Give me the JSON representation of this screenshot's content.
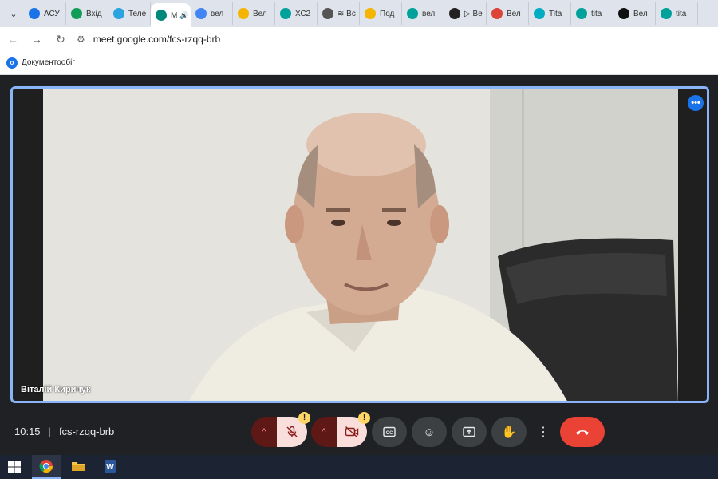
{
  "browser": {
    "tabs": [
      {
        "label": "АСУ",
        "favicon": "od-icon",
        "color": "#1a73e8"
      },
      {
        "label": "Вхід",
        "favicon": "folder-icon",
        "color": "#0f9d58"
      },
      {
        "label": "Теле",
        "favicon": "telegram-icon",
        "color": "#2aa3df"
      },
      {
        "label": "М",
        "favicon": "meet-icon",
        "color": "#00897b",
        "active": true
      },
      {
        "label": "вел",
        "favicon": "google-icon",
        "color": "#4285f4"
      },
      {
        "label": "Вел",
        "favicon": "h-icon",
        "color": "#f4b400"
      },
      {
        "label": "ХС2",
        "favicon": "ok-icon",
        "color": "#00a19a"
      },
      {
        "label": "≋ Вс",
        "favicon": "s-icon",
        "color": "#555555"
      },
      {
        "label": "Под",
        "favicon": "lock-icon",
        "color": "#f4b400"
      },
      {
        "label": "вел",
        "favicon": "ok-icon",
        "color": "#00a19a"
      },
      {
        "label": "▷ Ве",
        "favicon": "b-icon",
        "color": "#222222"
      },
      {
        "label": "Вел",
        "favicon": "target-icon",
        "color": "#db4437"
      },
      {
        "label": "Tita",
        "favicon": "titan-icon",
        "color": "#00acc1"
      },
      {
        "label": "tita",
        "favicon": "ok-icon",
        "color": "#00a19a"
      },
      {
        "label": "Вел",
        "favicon": "i-icon",
        "color": "#111111"
      },
      {
        "label": "tita",
        "favicon": "ok-icon",
        "color": "#00a19a"
      }
    ],
    "url": "meet.google.com/fcs-rzqq-brb",
    "bookmark": "Документообіг"
  },
  "meet": {
    "participant_name": "Віталій Киричук",
    "time": "10:15",
    "meeting_code": "fcs-rzqq-brb",
    "warning_badge": "!",
    "accent": "#8ab4f8",
    "leave_color": "#ea4335"
  }
}
